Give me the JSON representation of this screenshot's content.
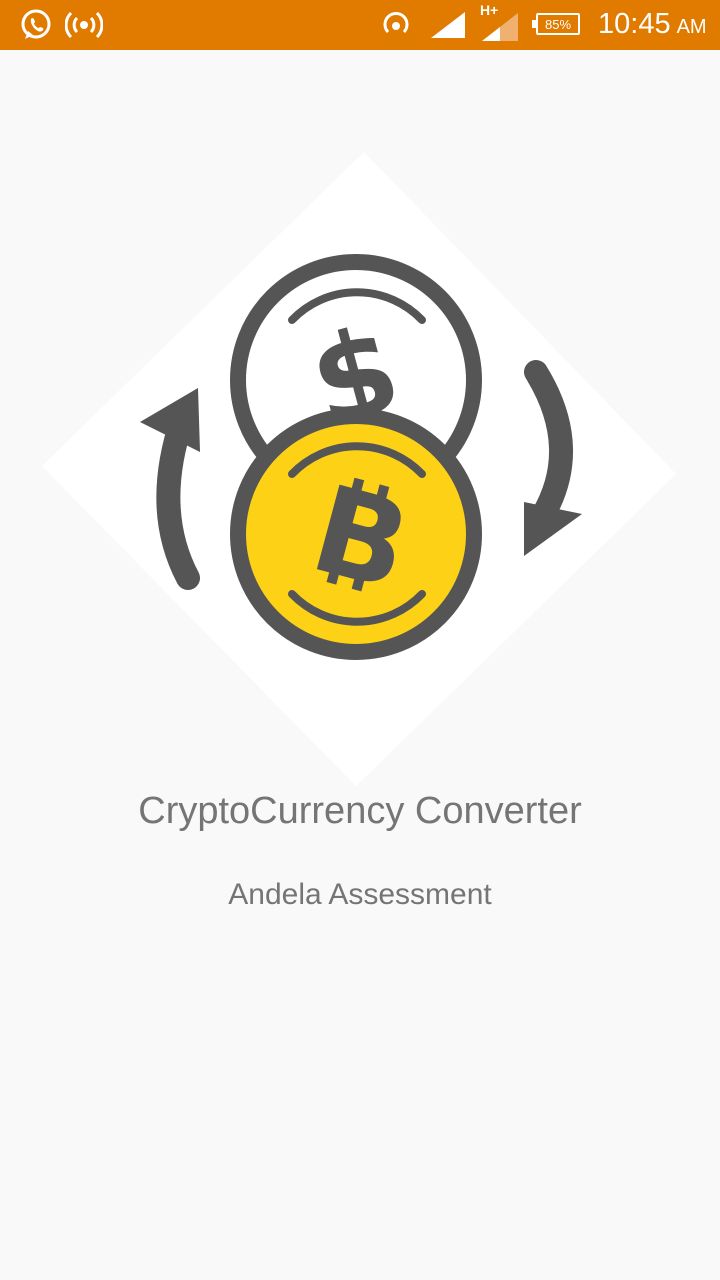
{
  "status_bar": {
    "background": "#e07b00",
    "icons_left": [
      "whatsapp-icon",
      "hotspot-icon"
    ],
    "icons_right": [
      "wifi-signal-icon",
      "cell-signal-icon",
      "cell-signal-hplus-icon"
    ],
    "network_type": "H+",
    "battery_percent": "85%",
    "time": "10:45",
    "am_pm": "AM"
  },
  "splash": {
    "logo_icon": "crypto-exchange-logo-icon",
    "coin_color": "#fcd116",
    "title": "CryptoCurrency Converter",
    "subtitle": "Andela Assessment",
    "text_color": "#757575"
  }
}
